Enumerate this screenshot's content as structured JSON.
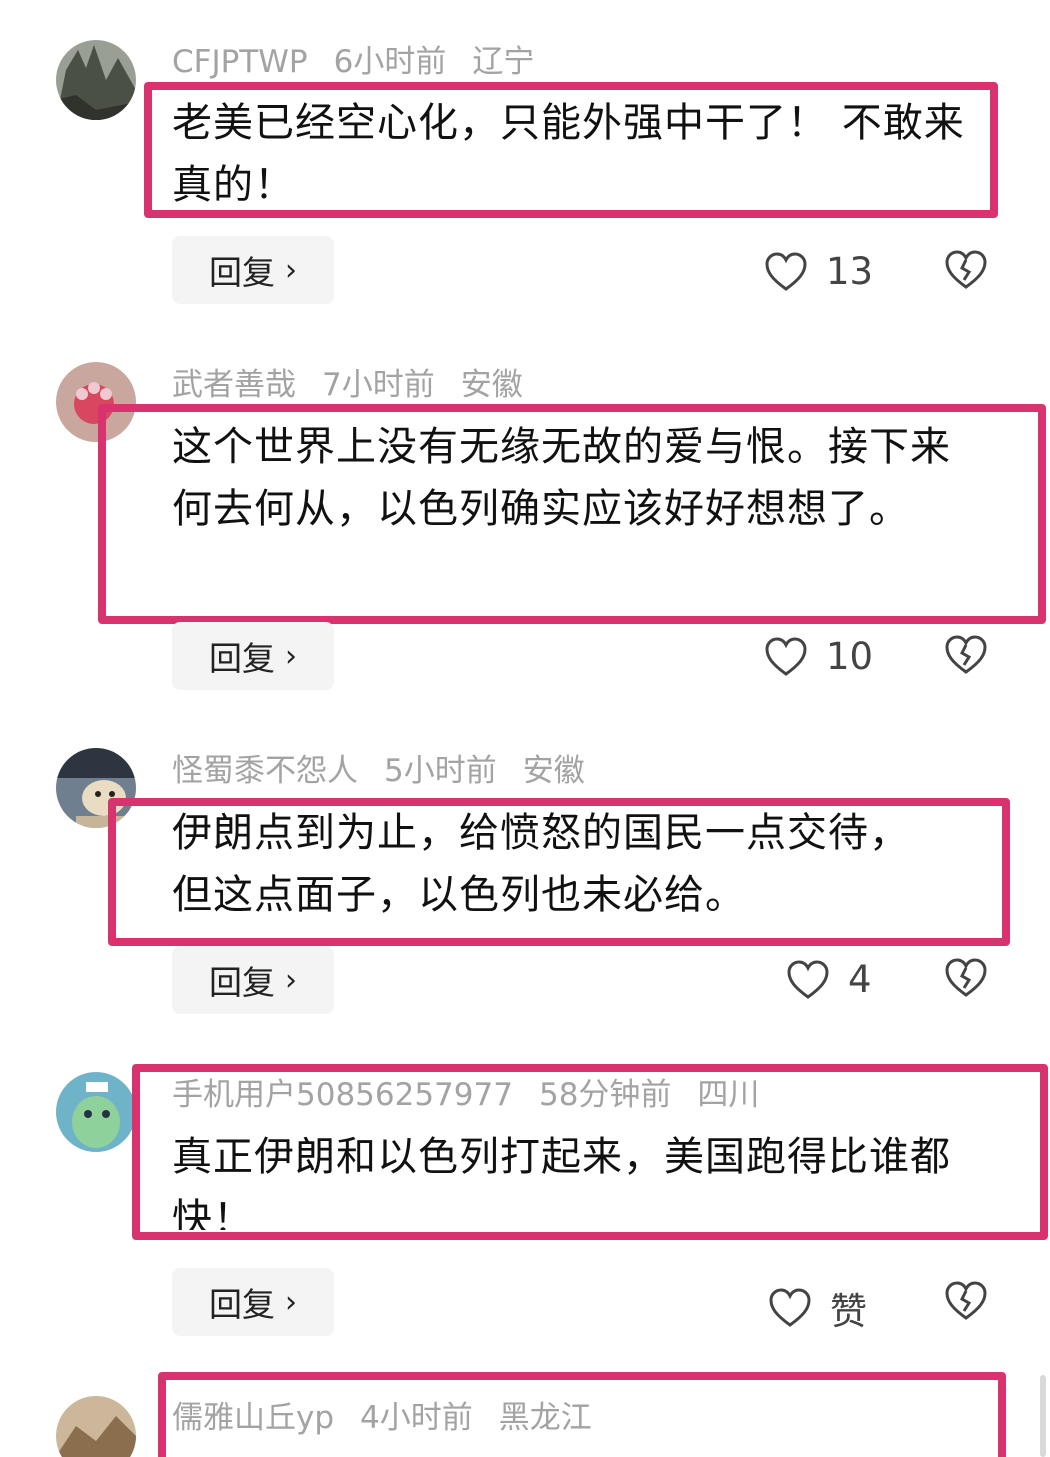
{
  "comments": [
    {
      "user": "CFJPTWP",
      "time": "6小时前",
      "location": "辽宁",
      "text": "老美已经空心化，只能外强中干了！ 不敢来真的！",
      "reply": "回复",
      "likes": "13"
    },
    {
      "user": "武者善哉",
      "time": "7小时前",
      "location": "安徽",
      "text": "这个世界上没有无缘无故的爱与恨。接下来何去何从，以色列确实应该好好想想了。",
      "reply": "回复",
      "likes": "10"
    },
    {
      "user": "怪蜀黍不怨人",
      "time": "5小时前",
      "location": "安徽",
      "text": "伊朗点到为止，给愤怒的国民一点交待，但这点面子，以色列也未必给。",
      "reply": "回复",
      "likes": "4"
    },
    {
      "user": "手机用户50856257977",
      "time": "58分钟前",
      "location": "四川",
      "text": "真正伊朗和以色列打起来，美国跑得比谁都快！",
      "reply": "回复",
      "likes": "赞"
    },
    {
      "user": "儒雅山丘yp",
      "time": "4小时前",
      "location": "黑龙江"
    }
  ],
  "colors": {
    "highlight": "#d9336f",
    "meta": "#a3a3a3",
    "reply_bg": "#f4f4f4"
  },
  "icons": {
    "like": "heart-outline-icon",
    "dislike": "broken-heart-icon",
    "reply_arrow": "chevron-right-icon"
  }
}
